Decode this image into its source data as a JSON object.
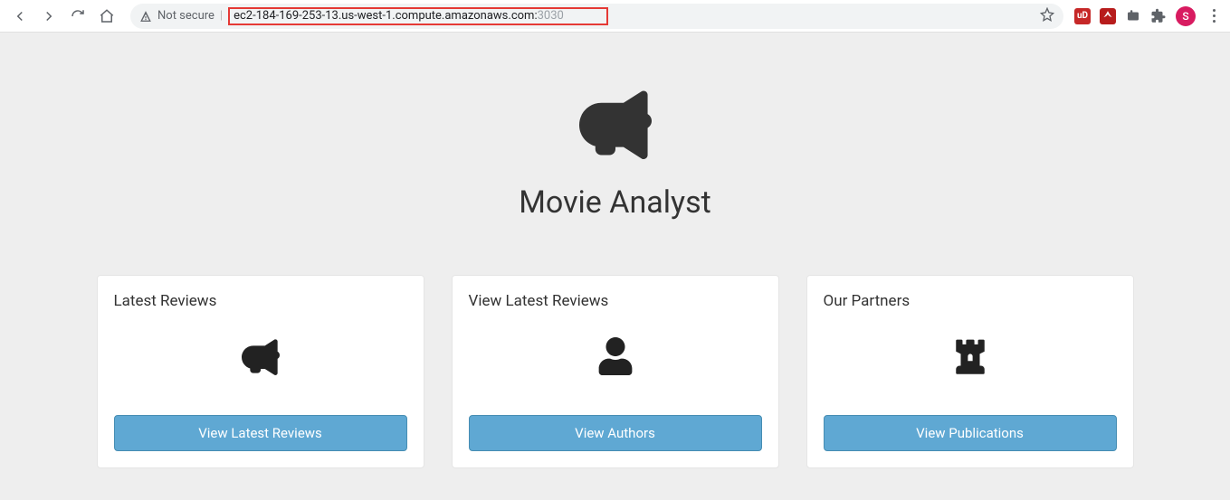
{
  "browser": {
    "not_secure_label": "Not secure",
    "url_host": "ec2-184-169-253-13.us-west-1.compute.amazonaws.com:",
    "url_port": "3030",
    "avatar_initial": "S",
    "ext_ublock": "uD"
  },
  "hero": {
    "title": "Movie Analyst"
  },
  "cards": [
    {
      "title": "Latest Reviews",
      "button": "View Latest Reviews",
      "icon": "bullhorn"
    },
    {
      "title": "View Latest Reviews",
      "button": "View Authors",
      "icon": "user"
    },
    {
      "title": "Our Partners",
      "button": "View Publications",
      "icon": "rook"
    }
  ]
}
